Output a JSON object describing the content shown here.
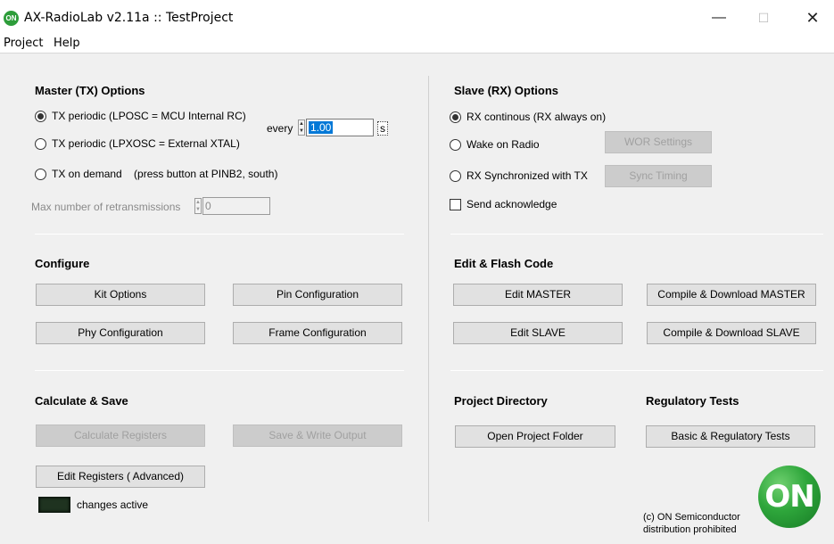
{
  "window": {
    "icon_text": "ON",
    "title": "AX-RadioLab v2.11a :: TestProject",
    "minimize": "—",
    "maximize": "☐",
    "close": "✕"
  },
  "menu": [
    "Project",
    "Help"
  ],
  "master": {
    "title": "Master (TX) Options",
    "options": [
      {
        "label": "TX periodic (LPOSC = MCU Internal RC)",
        "checked": true
      },
      {
        "label": "TX periodic (LPXOSC = External XTAL)",
        "checked": false
      },
      {
        "label": "TX on demand    (press button at PINB2, south)",
        "checked": false
      }
    ],
    "every_label": "every",
    "every_value": "1.00",
    "unit": "s",
    "max_retx_label": "Max number of retransmissions",
    "max_retx_value": "0"
  },
  "slave": {
    "title": "Slave (RX) Options",
    "options": [
      {
        "label": "RX continous (RX always on)",
        "checked": true
      },
      {
        "label": "Wake on Radio",
        "checked": false
      },
      {
        "label": "RX Synchronized with TX",
        "checked": false
      }
    ],
    "wor_button": "WOR Settings",
    "sync_button": "Sync Timing",
    "ack_label": "Send acknowledge"
  },
  "configure": {
    "title": "Configure",
    "kit_options": "Kit Options",
    "pin_config": "Pin Configuration",
    "phy_config": "Phy Configuration",
    "frame_config": "Frame Configuration"
  },
  "edit_flash": {
    "title": "Edit & Flash Code",
    "edit_master": "Edit MASTER",
    "compile_master": "Compile & Download MASTER",
    "edit_slave": "Edit SLAVE",
    "compile_slave": "Compile & Download SLAVE"
  },
  "calc": {
    "title": "Calculate & Save",
    "calc_registers": "Calculate Registers",
    "save_output": "Save & Write Output",
    "edit_registers": "Edit Registers ( Advanced)",
    "changes_active": "changes active"
  },
  "project_dir": {
    "title": "Project Directory",
    "open_folder": "Open Project Folder"
  },
  "regulatory": {
    "title": "Regulatory Tests",
    "button": "Basic & Regulatory Tests"
  },
  "footer": {
    "copyright": "(c) ON Semiconductor",
    "distribution": "distribution prohibited",
    "logo_text": "ON"
  }
}
